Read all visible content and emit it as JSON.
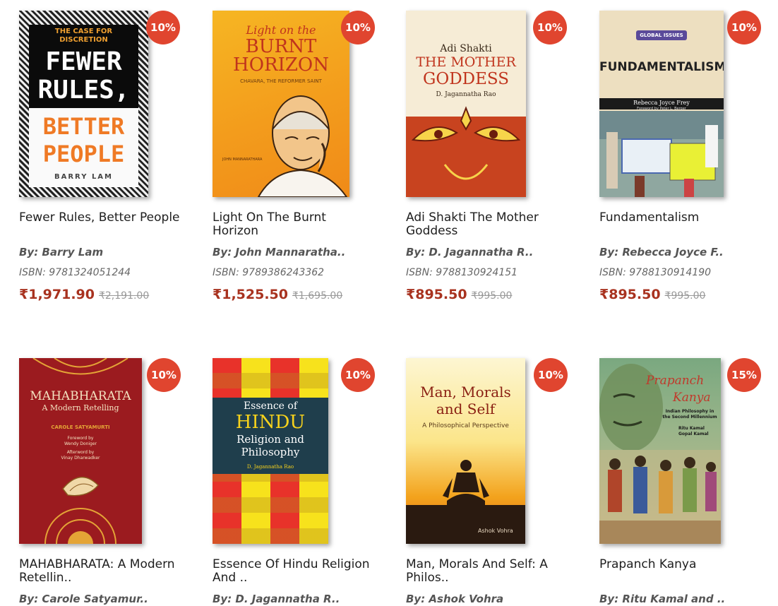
{
  "products": [
    {
      "discount": "10%",
      "title_line1": "Fewer Rules, Better People",
      "title_line2": "",
      "author": "By: Barry Lam",
      "isbn": "ISBN: 9781324051244",
      "price": "₹1,971.90",
      "mrp": "₹2,191.00",
      "cover": {
        "top": "THE CASE FOR DISCRETION",
        "l1": "FEWER",
        "l2": "RULES,",
        "l3": "BETTER",
        "l4": "PEOPLE",
        "author": "BARRY LAM"
      }
    },
    {
      "discount": "10%",
      "title_line1": "Light On The Burnt",
      "title_line2": "Horizon",
      "author": "By: John Mannaratha..",
      "isbn": "ISBN: 9789386243362",
      "price": "₹1,525.50",
      "mrp": "₹1,695.00",
      "cover": {
        "l1": "Light on the",
        "l2": "BURNT",
        "l3": "HORIZON",
        "sub": "CHAVARA, THE REFORMER SAINT",
        "author": "JOHN MANNARATHARA"
      }
    },
    {
      "discount": "10%",
      "title_line1": "Adi Shakti The Mother",
      "title_line2": "Goddess",
      "author": "By: D. Jagannatha R..",
      "isbn": "ISBN: 9788130924151",
      "price": "₹895.50",
      "mrp": "₹995.00",
      "cover": {
        "l1": "Adi Shakti",
        "l2": "THE MOTHER",
        "l3": "GODDESS",
        "author": "D. Jagannatha Rao"
      }
    },
    {
      "discount": "10%",
      "title_line1": "Fundamentalism",
      "title_line2": "",
      "author": "By: Rebecca Joyce F..",
      "isbn": "ISBN: 9788130914190",
      "price": "₹895.50",
      "mrp": "₹995.00",
      "cover": {
        "series": "GLOBAL ISSUES",
        "l1": "FUNDAMENTALISM",
        "author": "Rebecca Joyce Frey",
        "sub": "Foreword by Peter L. Berger"
      }
    },
    {
      "discount": "10%",
      "title_line1": "MAHABHARATA: A Modern",
      "title_line2": "Retellin..",
      "author": "By: Carole Satyamur..",
      "cover": {
        "l1": "MAHABHARATA",
        "l2": "A Modern Retelling",
        "author": "CAROLE SATYAMURTI",
        "f1": "Foreword by",
        "f2": "Wendy Doniger",
        "f3": "Afterword by",
        "f4": "Vinay Dharwadker"
      }
    },
    {
      "discount": "10%",
      "title_line1": "Essence Of Hindu Religion",
      "title_line2": "And ..",
      "author": "By: D. Jagannatha R..",
      "cover": {
        "l1": "Essence of",
        "l2": "HINDU",
        "l3": "Religion and",
        "l4": "Philosophy",
        "author": "D. Jagannatha Rao"
      }
    },
    {
      "discount": "10%",
      "title_line1": "Man, Morals And Self: A",
      "title_line2": "Philos..",
      "author": "By: Ashok Vohra",
      "cover": {
        "l1": "Man, Morals",
        "l2": "and Self",
        "sub": "A Philosophical Perspective",
        "author": "Ashok Vohra"
      }
    },
    {
      "discount": "15%",
      "title_line1": "Prapanch Kanya",
      "title_line2": "",
      "author": "By: Ritu Kamal and ..",
      "cover": {
        "l1": "Prapanch",
        "l2": "Kanya",
        "sub": "Indian Philosophy in the Second Millennium",
        "a1": "Ritu Kamal",
        "a2": "Gopal Kamal"
      }
    }
  ],
  "colors": {
    "badge": "#e0452f",
    "price": "#a8321f"
  }
}
